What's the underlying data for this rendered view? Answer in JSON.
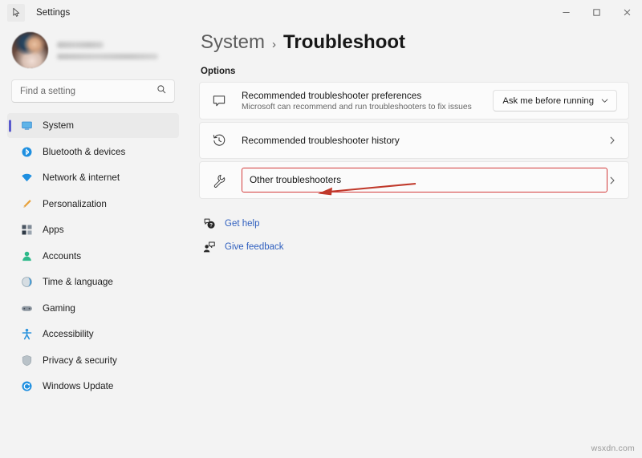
{
  "window": {
    "title": "Settings",
    "cursor_icon": "cursor-pointer-icon",
    "controls": {
      "minimize": "minimize-icon",
      "maximize": "maximize-icon",
      "close": "close-icon"
    }
  },
  "sidebar": {
    "profile": {
      "avatar": "user-avatar",
      "name_redacted": "",
      "email_redacted": ""
    },
    "search": {
      "placeholder": "Find a setting",
      "value": "",
      "icon": "search-icon"
    },
    "items": [
      {
        "label": "System",
        "icon": "monitor-icon",
        "selected": true
      },
      {
        "label": "Bluetooth & devices",
        "icon": "bluetooth-icon",
        "selected": false
      },
      {
        "label": "Network & internet",
        "icon": "wifi-icon",
        "selected": false
      },
      {
        "label": "Personalization",
        "icon": "paintbrush-icon",
        "selected": false
      },
      {
        "label": "Apps",
        "icon": "apps-grid-icon",
        "selected": false
      },
      {
        "label": "Accounts",
        "icon": "person-icon",
        "selected": false
      },
      {
        "label": "Time & language",
        "icon": "clock-globe-icon",
        "selected": false
      },
      {
        "label": "Gaming",
        "icon": "gamepad-icon",
        "selected": false
      },
      {
        "label": "Accessibility",
        "icon": "accessibility-person-icon",
        "selected": false
      },
      {
        "label": "Privacy & security",
        "icon": "shield-icon",
        "selected": false
      },
      {
        "label": "Windows Update",
        "icon": "refresh-circle-icon",
        "selected": false
      }
    ]
  },
  "main": {
    "breadcrumb": {
      "parent": "System",
      "separator": "›",
      "current": "Troubleshoot"
    },
    "section_label": "Options",
    "cards": [
      {
        "icon": "speech-bubble-icon",
        "title": "Recommended troubleshooter preferences",
        "subtitle": "Microsoft can recommend and run troubleshooters to fix issues",
        "control": "dropdown",
        "dropdown_value": "Ask me before running",
        "dropdown_icon": "chevron-down-icon"
      },
      {
        "icon": "history-clock-icon",
        "title": "Recommended troubleshooter history",
        "subtitle": "",
        "control": "chevron",
        "chevron_icon": "chevron-right-icon"
      },
      {
        "icon": "wrench-icon",
        "title": "Other troubleshooters",
        "subtitle": "",
        "control": "chevron",
        "chevron_icon": "chevron-right-icon",
        "highlighted": true
      }
    ],
    "links": [
      {
        "label": "Get help",
        "icon": "help-question-icon"
      },
      {
        "label": "Give feedback",
        "icon": "feedback-person-icon"
      }
    ]
  },
  "annotation": {
    "highlight_color": "#d33b3b",
    "arrow": "left-pointing-arrow",
    "target": "Other troubleshooters"
  },
  "watermark": "wsxdn.com"
}
